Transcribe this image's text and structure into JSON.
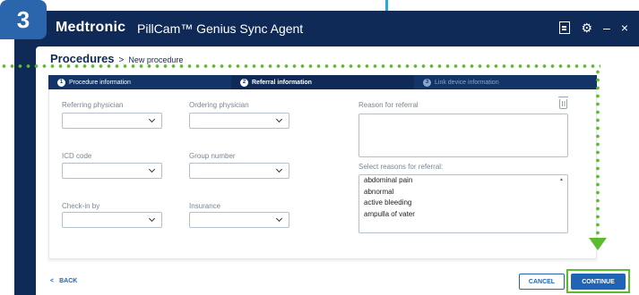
{
  "step_badge": "3",
  "titlebar": {
    "brand": "Medtronic",
    "app_name": "PillCam™ Genius Sync Agent",
    "minimize": "–",
    "close": "×"
  },
  "breadcrumb": {
    "main": "Procedures",
    "separator": ">",
    "sub": "New procedure"
  },
  "stepper": [
    {
      "num": "1",
      "label": "Procedure information",
      "state": "done"
    },
    {
      "num": "2",
      "label": "Referral information",
      "state": "active"
    },
    {
      "num": "3",
      "label": "Link device information",
      "state": "inactive"
    }
  ],
  "form": {
    "referring_physician": "Referring physician",
    "ordering_physician": "Ordering physician",
    "icd_code": "ICD code",
    "group_number": "Group number",
    "check_in_by": "Check-in by",
    "insurance": "Insurance",
    "reason_for_referral": "Reason for referral",
    "select_reasons": "Select reasons for referral:",
    "reasons": [
      "abdominal pain",
      "abnormal",
      "active bleeding",
      "ampulla of vater"
    ]
  },
  "footer": {
    "back": "BACK",
    "cancel": "CANCEL",
    "continue": "CONTINUE"
  },
  "colors": {
    "navy": "#0f2a56",
    "accent_blue": "#1f64b5",
    "highlight_green": "#5dbb2e"
  }
}
